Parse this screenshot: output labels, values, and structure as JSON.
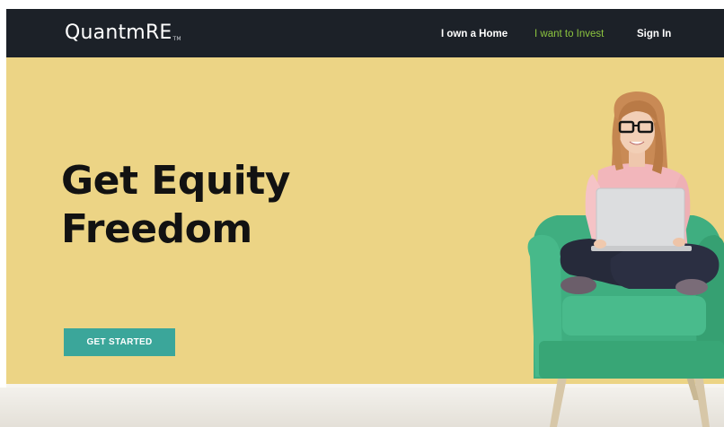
{
  "header": {
    "logo_text": "QuantmRE",
    "logo_mark": "TM",
    "nav": [
      {
        "label": "I own a Home"
      },
      {
        "label": "I want to Invest"
      },
      {
        "label": "Sign In"
      }
    ]
  },
  "hero": {
    "headline_line1": "Get Equity",
    "headline_line2": "Freedom",
    "cta_label": "GET STARTED",
    "illustration": "woman-on-armchair-with-laptop"
  },
  "colors": {
    "navbar_bg": "#1c2128",
    "nav_active": "#8dc63f",
    "hero_bg": "#ecd485",
    "cta_bg": "#3ba69a",
    "chair": "#3fae80"
  }
}
